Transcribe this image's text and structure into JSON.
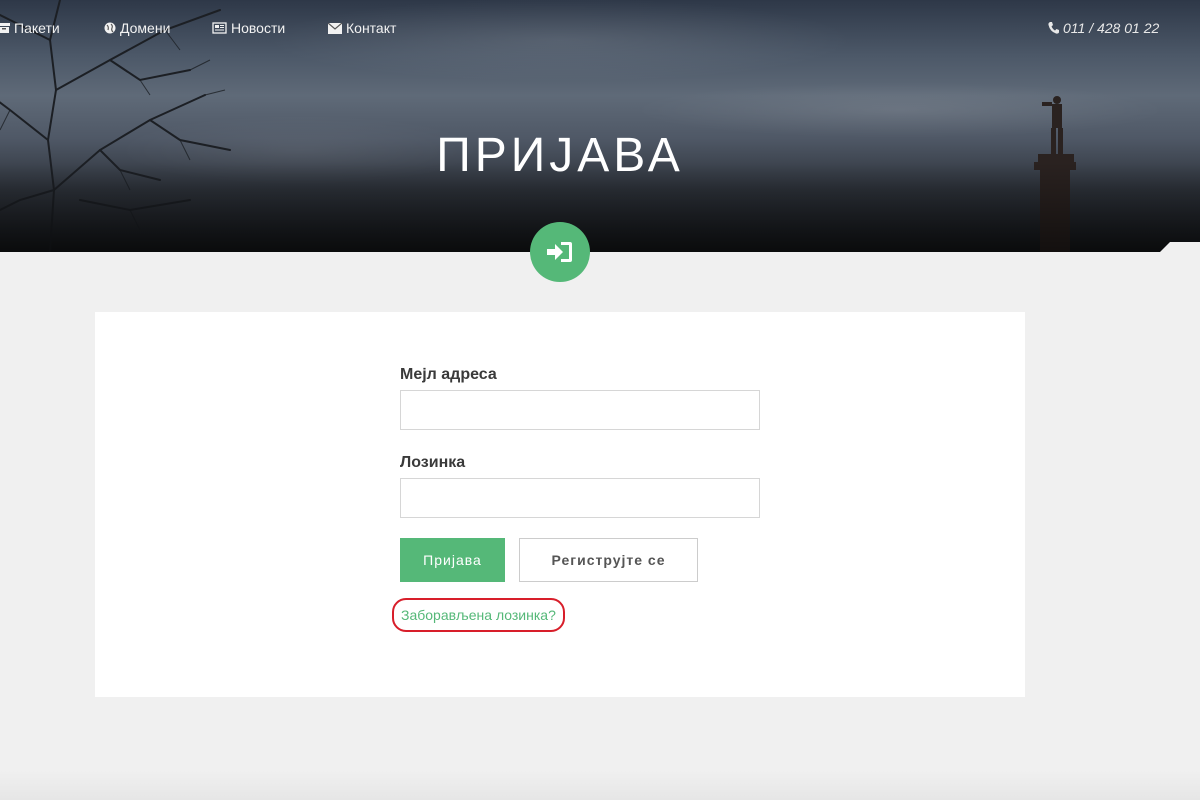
{
  "nav": {
    "items": [
      {
        "label": "Пакети",
        "icon": "archive-icon"
      },
      {
        "label": "Домени",
        "icon": "globe-icon"
      },
      {
        "label": "Новости",
        "icon": "newspaper-icon"
      },
      {
        "label": "Контакт",
        "icon": "envelope-icon"
      }
    ],
    "phone": "011 / 428 01 22",
    "phone_icon": "phone-icon"
  },
  "hero": {
    "title": "ПРИЈАВА",
    "badge_icon": "sign-in-icon"
  },
  "form": {
    "email_label": "Мејл адреса",
    "email_value": "",
    "password_label": "Лозинка",
    "password_value": "",
    "login_button": "Пријава",
    "register_button": "Региструјте се",
    "forgot_link": "Заборављена лозинка?"
  },
  "colors": {
    "accent": "#55b878",
    "highlight_circle": "#d81e2a",
    "background": "#f0f0f0"
  }
}
